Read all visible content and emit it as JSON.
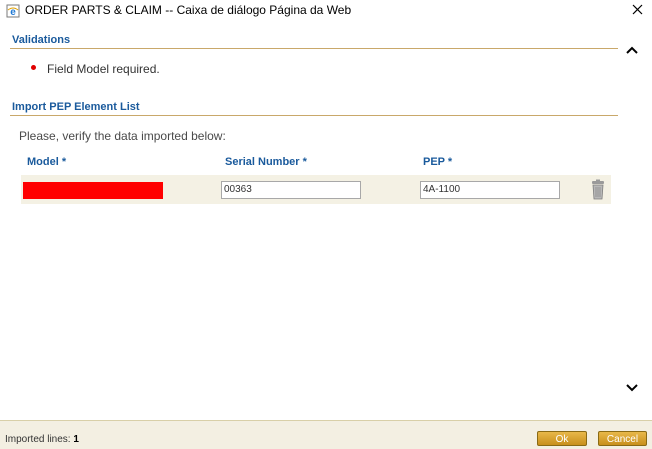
{
  "window": {
    "title": "ORDER PARTS & CLAIM -- Caixa de diálogo Página da Web",
    "icon": "ie-page-icon",
    "close_icon": "close-icon"
  },
  "validations": {
    "title": "Validations",
    "messages": [
      "Field Model required."
    ],
    "bullet_color": "#e00000"
  },
  "import": {
    "title": "Import PEP Element List",
    "instruction": "Please, verify the data imported below:",
    "columns": [
      "Model *",
      "Serial Number *",
      "PEP *"
    ],
    "rows": [
      {
        "model": "",
        "serial_number": "00363",
        "pep": "4A-1100"
      }
    ]
  },
  "footer": {
    "imported_label": "Imported lines:",
    "imported_count": "1",
    "ok_label": "Ok",
    "cancel_label": "Cancel"
  },
  "colors": {
    "section_title": "#1a5a9c",
    "accent": "#c88f1c",
    "row_background": "#f4f1e4",
    "error": "#ff0000"
  }
}
